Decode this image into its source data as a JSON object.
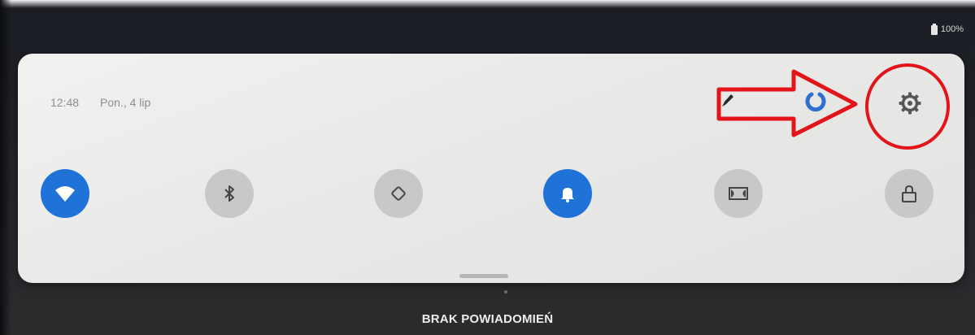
{
  "status_bar": {
    "battery_text": "100%",
    "battery_icon": "battery-full-icon"
  },
  "quick_settings": {
    "time": "12:48",
    "date": "Pon., 4 lip",
    "header_icons": [
      "edit-icon",
      "power-icon",
      "settings-icon"
    ],
    "tiles": [
      {
        "icon": "wifi-icon",
        "active": true
      },
      {
        "icon": "bluetooth-icon",
        "active": false
      },
      {
        "icon": "auto-rotate-icon",
        "active": false
      },
      {
        "icon": "notification-bell-icon",
        "active": true
      },
      {
        "icon": "dolby-icon",
        "active": false
      },
      {
        "icon": "lock-icon",
        "active": false
      }
    ]
  },
  "annotation": {
    "color": "#e2151a",
    "marks": [
      "arrow-icon",
      "highlight-circle"
    ]
  },
  "notifications": {
    "empty_label": "BRAK POWIADOMIEŃ"
  },
  "colors": {
    "accent": "#1f73d8",
    "panel": "#eeeeec",
    "inactive_tile": "#c8c8c6"
  }
}
